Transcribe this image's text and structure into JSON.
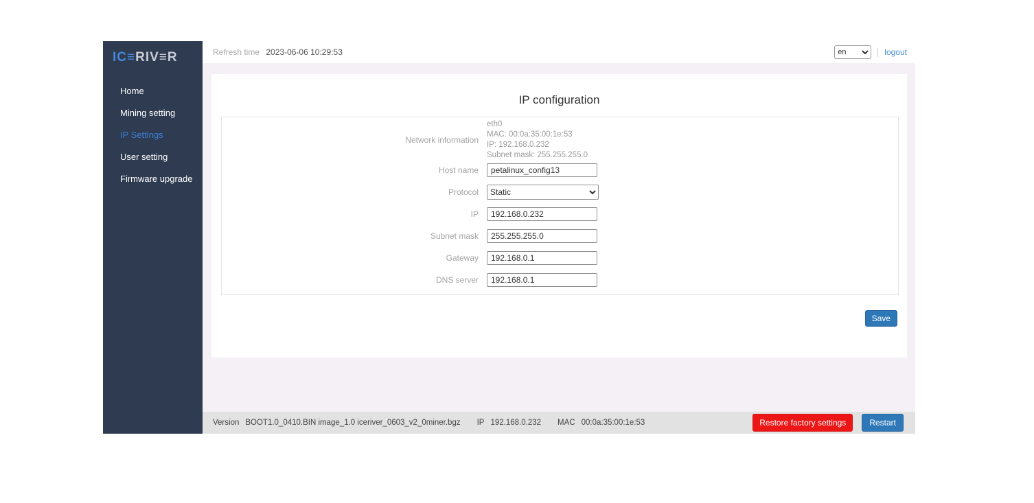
{
  "logo": {
    "ice": "IC≡",
    "river": "RIV≡R"
  },
  "header": {
    "refresh_label": "Refresh time",
    "refresh_value": "2023-06-06 10:29:53",
    "language_selected": "en",
    "logout_label": "logout"
  },
  "sidebar": {
    "items": [
      {
        "label": "Home",
        "active": false
      },
      {
        "label": "Mining setting",
        "active": false
      },
      {
        "label": "IP Settings",
        "active": true
      },
      {
        "label": "User setting",
        "active": false
      },
      {
        "label": "Firmware upgrade",
        "active": false
      }
    ]
  },
  "main": {
    "title": "IP configuration",
    "network_info": {
      "label": "Network information",
      "lines": [
        "eth0",
        "MAC: 00:0a:35:00:1e:53",
        "IP: 192.168.0.232",
        "Subnet mask: 255.255.255.0"
      ]
    },
    "form": [
      {
        "label": "Host name",
        "value": "petalinux_config13",
        "type": "input"
      },
      {
        "label": "Protocol",
        "value": "Static",
        "type": "select"
      },
      {
        "label": "IP",
        "value": "192.168.0.232",
        "type": "input"
      },
      {
        "label": "Subnet mask",
        "value": "255.255.255.0",
        "type": "input"
      },
      {
        "label": "Gateway",
        "value": "192.168.0.1",
        "type": "input"
      },
      {
        "label": "DNS server",
        "value": "192.168.0.1",
        "type": "input"
      }
    ],
    "save_button": "Save"
  },
  "footer": {
    "version_label": "Version",
    "version_value": "BOOT1.0_0410.BIN image_1.0 iceriver_0603_v2_0miner.bgz",
    "ip_label": "IP",
    "ip_value": "192.168.0.232",
    "mac_label": "MAC",
    "mac_value": "00:0a:35:00:1e:53",
    "restore_button": "Restore factory settings",
    "restart_button": "Restart"
  },
  "colors": {
    "sidebar_bg": "#2e3b50",
    "active_nav": "#3c7fd6",
    "content_bg": "#f5f0f6",
    "footer_bg": "#e2e2e2",
    "primary_button": "#2e78b7",
    "danger_button": "#ec1616",
    "link": "#4a8fd4",
    "logo_blue": "#4587d8",
    "logo_silver": "#c9cdd6"
  }
}
